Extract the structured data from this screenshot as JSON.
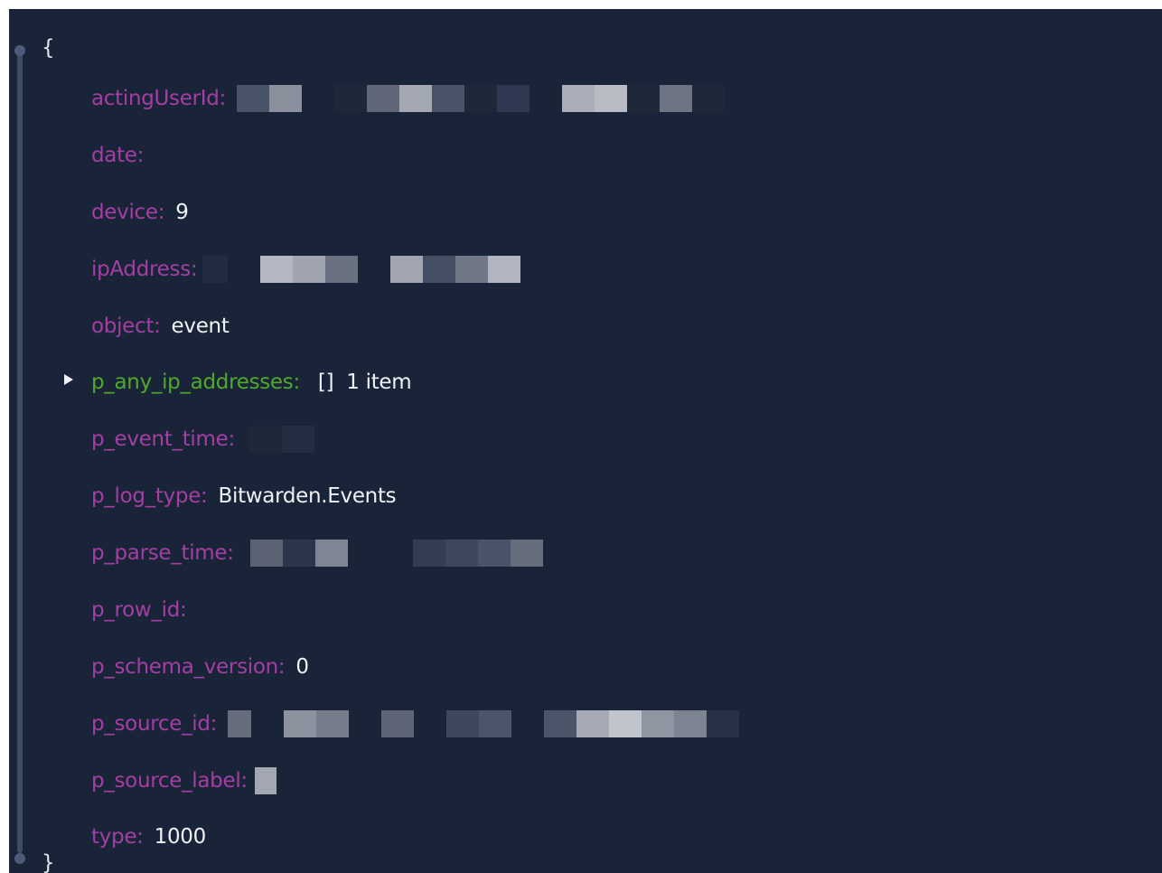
{
  "json_viewer": {
    "open_brace": "{",
    "close_brace": "}",
    "fields": [
      {
        "key": "actingUserId:",
        "redacted": true,
        "value": ""
      },
      {
        "key": "date:",
        "redacted": false,
        "value": ""
      },
      {
        "key": "device:",
        "redacted": false,
        "value": "9"
      },
      {
        "key": "ipAddress:",
        "redacted": true,
        "value": ""
      },
      {
        "key": "object:",
        "redacted": false,
        "value": "event"
      },
      {
        "key": "p_any_ip_addresses:",
        "redacted": false,
        "value": "[]",
        "count": "1 item",
        "expandable": true
      },
      {
        "key": "p_event_time:",
        "redacted": true,
        "value": ""
      },
      {
        "key": "p_log_type:",
        "redacted": false,
        "value": "Bitwarden.Events"
      },
      {
        "key": "p_parse_time:",
        "redacted": true,
        "value": ""
      },
      {
        "key": "p_row_id:",
        "redacted": false,
        "value": ""
      },
      {
        "key": "p_schema_version:",
        "redacted": false,
        "value": "0"
      },
      {
        "key": "p_source_id:",
        "redacted": true,
        "value": ""
      },
      {
        "key": "p_source_label:",
        "redacted": true,
        "value": ""
      },
      {
        "key": "type:",
        "redacted": false,
        "value": "1000"
      }
    ]
  },
  "colors": {
    "background": "#1a2438",
    "key": "#a33fa3",
    "key_expandable": "#50a82c",
    "value": "#eef1f6",
    "gutter": "#3e4c66"
  },
  "icons": {
    "expand": "caret-right-icon"
  }
}
